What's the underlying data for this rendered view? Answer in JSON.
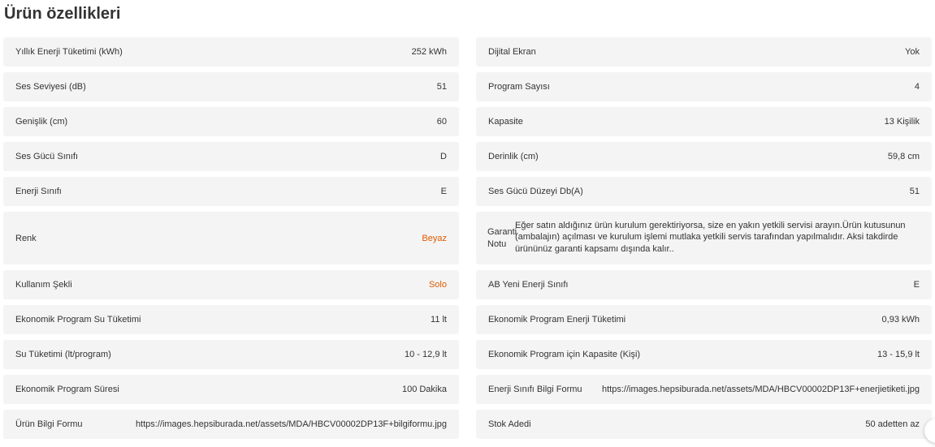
{
  "title": "Ürün özellikleri",
  "left_rows": [
    {
      "label": "Yıllık Enerji Tüketimi (kWh)",
      "value": "252 kWh"
    },
    {
      "label": "Ses Seviyesi (dB)",
      "value": "51"
    },
    {
      "label": "Genişlik (cm)",
      "value": "60"
    },
    {
      "label": "Ses Gücü Sınıfı",
      "value": "D"
    },
    {
      "label": "Enerji Sınıfı",
      "value": "E"
    },
    {
      "label": "Renk",
      "value": "Beyaz"
    },
    {
      "label": "Kullanım Şekli",
      "value": "Solo"
    },
    {
      "label": "Ekonomik Program Su Tüketimi",
      "value": "11 lt"
    },
    {
      "label": "Su Tüketimi (lt/program)",
      "value": "10 - 12,9 lt"
    },
    {
      "label": "Ekonomik Program Süresi",
      "value": "100 Dakika"
    },
    {
      "label": "Ürün Bilgi Formu",
      "value": "https://images.hepsiburada.net/assets/MDA/HBCV00002DP13F+bilgiformu.jpg"
    }
  ],
  "right_rows": [
    {
      "label": "Dijital Ekran",
      "value": "Yok"
    },
    {
      "label": "Program Sayısı",
      "value": "4"
    },
    {
      "label": "Kapasite",
      "value": "13 Kişilik"
    },
    {
      "label": "Derinlik (cm)",
      "value": "59,8 cm"
    },
    {
      "label": "Ses Gücü Düzeyi Db(A)",
      "value": "51"
    },
    {
      "label": "Garanti Notu",
      "value": "Eğer satın aldığınız ürün kurulum gerektiriyorsa, size en yakın yetkili servisi arayın.Ürün kutusunun (ambalajın) açılması ve kurulum işlemi mutlaka yetkili servis tarafından yapılmalıdır. Aksi takdirde ürününüz garanti kapsamı dışında kalır.."
    },
    {
      "label": "AB Yeni Enerji Sınıfı",
      "value": "E"
    },
    {
      "label": "Ekonomik Program Enerji Tüketimi",
      "value": "0,93 kWh"
    },
    {
      "label": "Ekonomik Program için Kapasite (Kişi)",
      "value": "13 - 15,9 lt"
    },
    {
      "label": "Enerji Sınıfı Bilgi Formu",
      "value": "https://images.hepsiburada.net/assets/MDA/HBCV00002DP13F+enerjietiketi.jpg"
    },
    {
      "label": "Stok Adedi",
      "value": "50 adetten az"
    }
  ],
  "colors": {
    "accent": "#e05a00",
    "row_background": "#f4f4f4",
    "text": "#333333"
  }
}
